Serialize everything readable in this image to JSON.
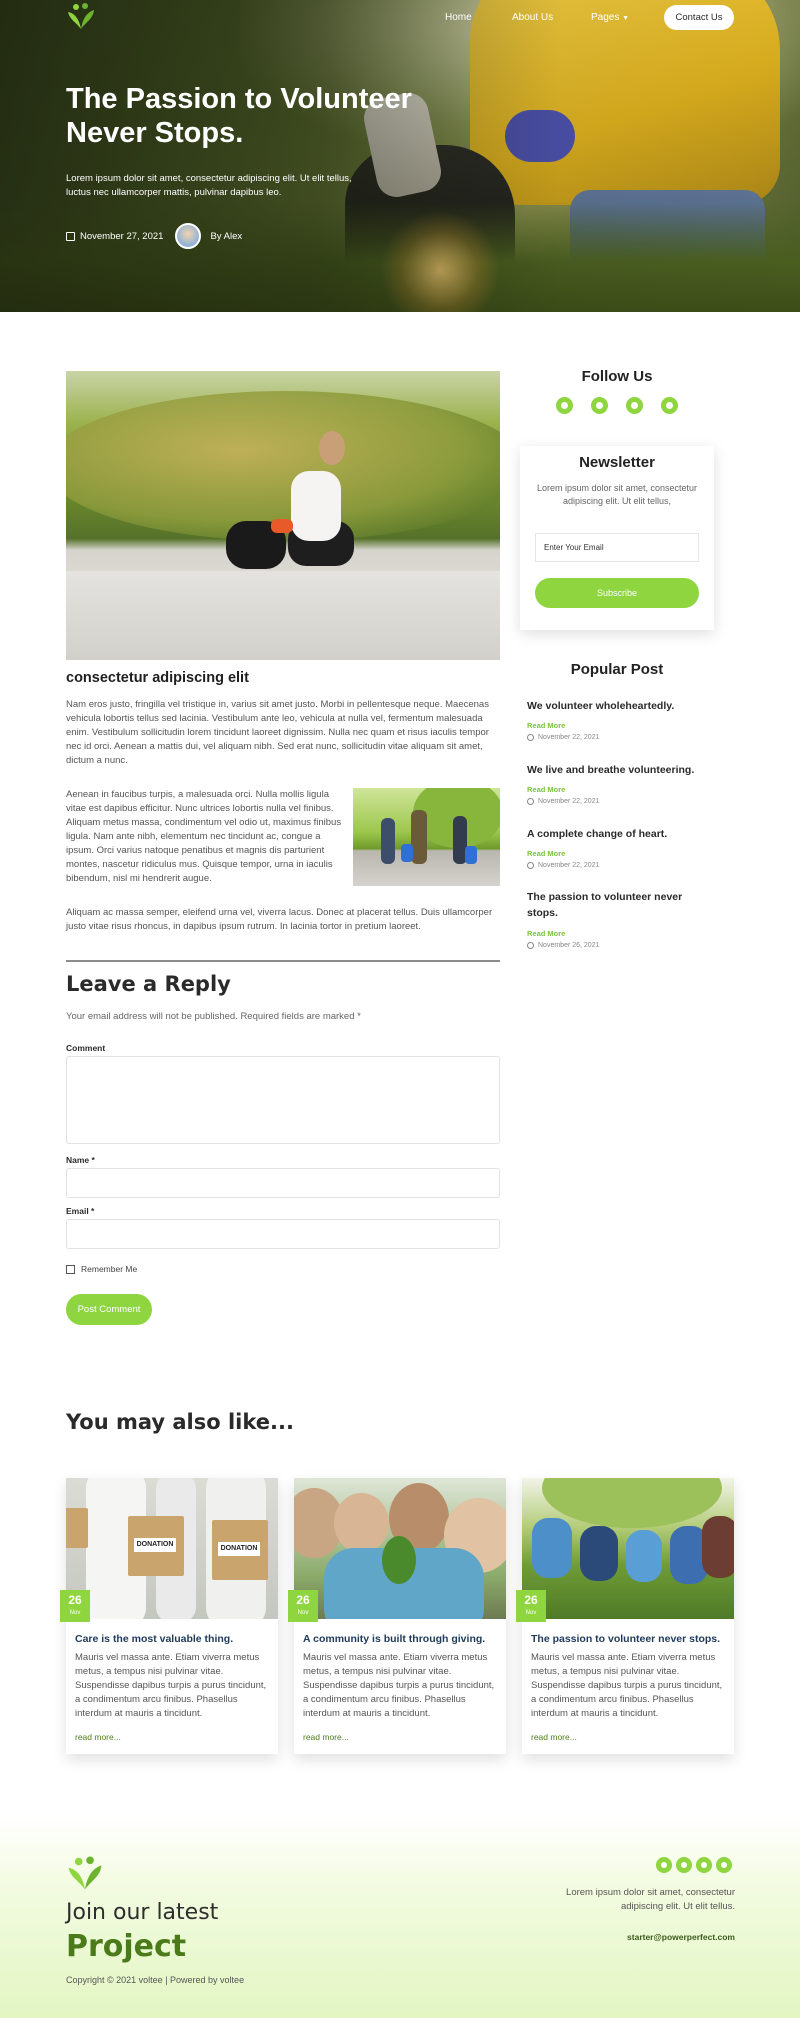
{
  "nav": {
    "links": [
      "Home",
      "About Us",
      "Pages"
    ],
    "cta": "Contact Us"
  },
  "hero": {
    "title": "The Passion to Volunteer Never Stops.",
    "description": "Lorem ipsum dolor sit amet, consectetur adipiscing elit. Ut elit tellus, luctus nec ullamcorper mattis, pulvinar dapibus leo.",
    "date": "November 27, 2021",
    "author": "By Alex"
  },
  "post": {
    "heading": "consectetur adipiscing elit",
    "para1": "Nam eros justo, fringilla vel tristique in, varius sit amet justo. Morbi in pellentesque neque. Maecenas vehicula lobortis tellus sed lacinia. Vestibulum ante leo, vehicula at nulla vel, fermentum malesuada enim. Vestibulum sollicitudin lorem tincidunt laoreet dignissim. Nulla nec quam et risus iaculis tempor nec id orci. Aenean a mattis dui, vel aliquam nibh. Sed erat nunc, sollicitudin vitae aliquam sit amet, dictum a nunc.",
    "para2": "Aenean in faucibus turpis, a malesuada orci. Nulla mollis ligula vitae est dapibus efficitur. Nunc ultrices lobortis nulla vel finibus. Aliquam metus massa, condimentum vel odio ut, maximus finibus ligula. Nam ante nibh, elementum nec tincidunt ac, congue a ipsum. Orci varius natoque penatibus et magnis dis parturient montes, nascetur ridiculus mus. Quisque tempor, urna in iaculis bibendum, nisl mi hendrerit augue.",
    "para3": "Aliquam ac massa semper, eleifend urna vel, viverra lacus. Donec at placerat tellus. Duis ullamcorper justo vitae risus rhoncus, in dapibus ipsum rutrum. In lacinia tortor in pretium laoreet."
  },
  "reply": {
    "heading": "Leave a Reply",
    "note": "Your email address will not be published. Required fields are marked *",
    "comment_label": "Comment",
    "name_label": "Name *",
    "email_label": "Email *",
    "remember": "Remember Me",
    "submit": "Post Comment"
  },
  "sidebar": {
    "follow_heading": "Follow Us",
    "social_icons": [
      "facebook-icon",
      "twitter-icon",
      "skype-icon",
      "instagram-icon"
    ],
    "newsletter": {
      "heading": "Newsletter",
      "text": "Lorem ipsum dolor sit amet, consectetur adipiscing elit. Ut elit tellus,",
      "placeholder": "Enter Your Email",
      "button": "Subscribe"
    },
    "popular_heading": "Popular Post",
    "popular": [
      {
        "title": "We volunteer wholeheartedly.",
        "read": "Read More",
        "date": "November 22, 2021"
      },
      {
        "title": "We live and breathe volunteering.",
        "read": "Read More",
        "date": "November 22, 2021"
      },
      {
        "title": "A complete change of heart.",
        "read": "Read More",
        "date": "November 22, 2021"
      },
      {
        "title": "The passion to volunteer never stops.",
        "read": "Read More",
        "date": "November 26, 2021"
      }
    ]
  },
  "related": {
    "heading": "You may also like...",
    "cards": [
      {
        "day": "26",
        "month": "Nov",
        "title": "Care is the most valuable thing.",
        "text": "Mauris vel massa ante. Etiam viverra metus metus, a tempus nisi pulvinar vitae. Suspendisse dapibus turpis a purus tincidunt, a condimentum arcu finibus. Phasellus interdum at mauris a tincidunt.",
        "link": "read more...",
        "box_label": "DONATION"
      },
      {
        "day": "26",
        "month": "Nov",
        "title": "A community is built through giving.",
        "text": "Mauris vel massa ante. Etiam viverra metus metus, a tempus nisi pulvinar vitae. Suspendisse dapibus turpis a purus tincidunt, a condimentum arcu finibus. Phasellus interdum at mauris a tincidunt.",
        "link": "read more..."
      },
      {
        "day": "26",
        "month": "Nov",
        "title": "The passion to volunteer never stops.",
        "text": "Mauris vel massa ante. Etiam viverra metus metus, a tempus nisi pulvinar vitae. Suspendisse dapibus turpis a purus tincidunt, a condimentum arcu finibus. Phasellus interdum at mauris a tincidunt.",
        "link": "read more..."
      }
    ]
  },
  "footer": {
    "join": "Join our latest",
    "project": "Project",
    "copyright": "Copyright © 2021 voltee | Powered by voltee",
    "social_icons": [
      "facebook-icon",
      "twitter-icon",
      "email-icon",
      "skype-icon"
    ],
    "description": "Lorem ipsum dolor sit amet, consectetur adipiscing elit. Ut elit tellus.",
    "email": "starter@powerperfect.com"
  },
  "colors": {
    "accent": "#8ed53f",
    "accent_dark": "#4a7a19",
    "card_title": "#1f3a5a"
  }
}
